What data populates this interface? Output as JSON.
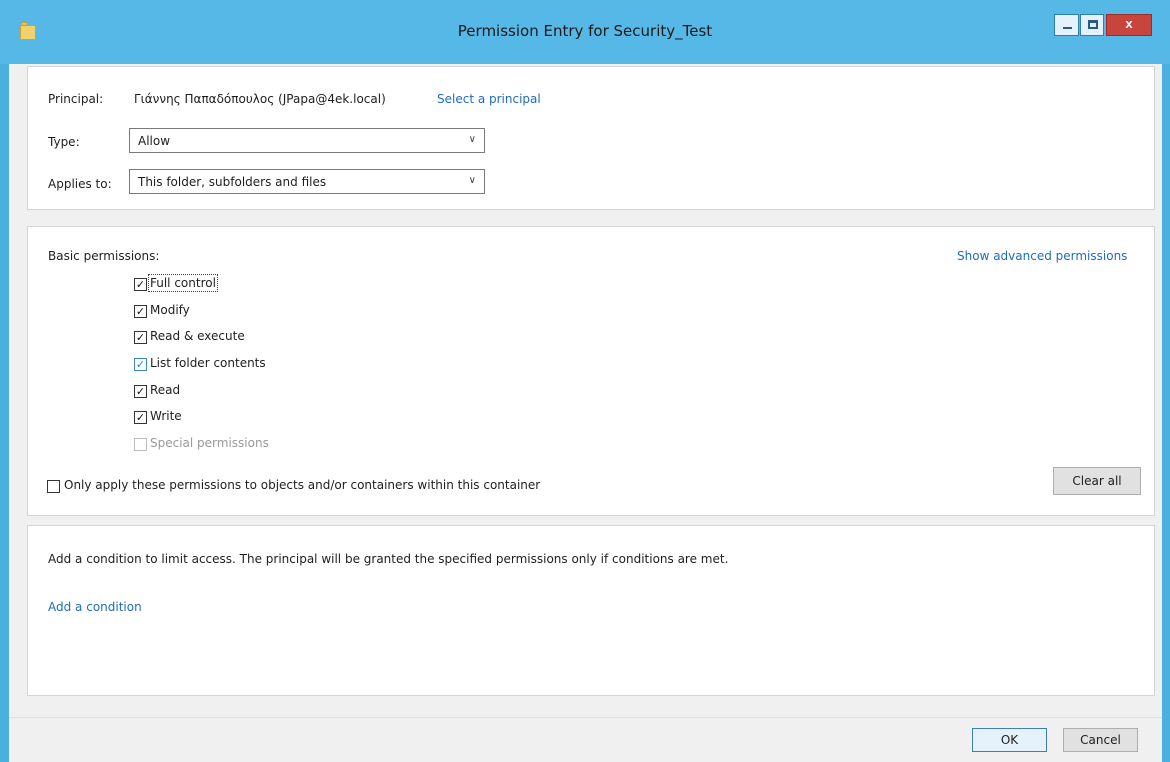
{
  "window": {
    "title": "Permission Entry for Security_Test",
    "icon": "folder-icon",
    "controls": {
      "minimize": "minimize-icon",
      "maximize": "maximize-icon",
      "close": "close-icon",
      "close_glyph": "x"
    }
  },
  "principal": {
    "label": "Principal:",
    "value": "Γιάννης Παπαδόπουλος (JPapa@4ek.local)",
    "select_link": "Select a principal"
  },
  "type": {
    "label": "Type:",
    "selected": "Allow"
  },
  "applies_to": {
    "label": "Applies to:",
    "selected": "This folder, subfolders and files"
  },
  "permissions": {
    "heading": "Basic permissions:",
    "show_advanced_link": "Show advanced permissions",
    "items": [
      {
        "label": "Full control",
        "checked": true,
        "state": "checked"
      },
      {
        "label": "Modify",
        "checked": true,
        "state": "checked"
      },
      {
        "label": "Read & execute",
        "checked": true,
        "state": "checked"
      },
      {
        "label": "List folder contents",
        "checked": true,
        "state": "checked"
      },
      {
        "label": "Read",
        "checked": true,
        "state": "checked"
      },
      {
        "label": "Write",
        "checked": true,
        "state": "checked"
      },
      {
        "label": "Special permissions",
        "checked": false,
        "state": "disabled"
      }
    ],
    "only_apply_label": "Only apply these permissions to objects and/or containers within this container",
    "only_apply_checked": false,
    "clear_all_label": "Clear all"
  },
  "condition": {
    "description": "Add a condition to limit access. The principal will be granted the specified permissions only if conditions are met.",
    "add_link": "Add a condition"
  },
  "footer": {
    "ok_label": "OK",
    "cancel_label": "Cancel"
  },
  "colors": {
    "titlebar": "#55b8e6",
    "link": "#1f6bbf",
    "close_button": "#c7453c"
  }
}
